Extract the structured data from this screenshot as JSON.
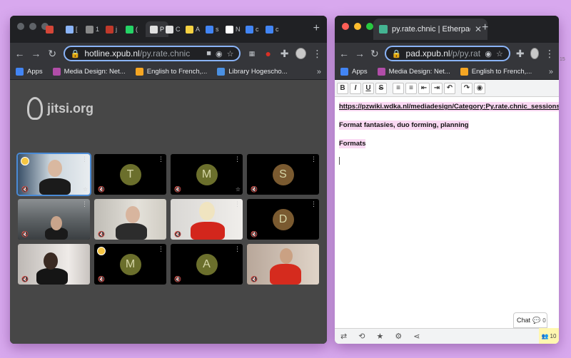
{
  "left_window": {
    "tabs": [
      {
        "label": "",
        "favicon_color": "#d44638",
        "icon": "gmail-icon"
      },
      {
        "label": "[",
        "favicon_color": "#8ab4f8",
        "icon": "page-icon"
      },
      {
        "label": "1",
        "favicon_color": "#888888",
        "icon": "box-icon"
      },
      {
        "label": "j",
        "favicon_color": "#c0392b",
        "icon": "red-icon"
      },
      {
        "label": "(",
        "favicon_color": "#25d366",
        "icon": "whatsapp-icon"
      },
      {
        "label": "P",
        "favicon_color": "#e0e0e0",
        "icon": "jitsi-icon",
        "active": true
      },
      {
        "label": "C",
        "favicon_color": "#e0e0e0",
        "icon": "page-icon"
      },
      {
        "label": "A",
        "favicon_color": "#f5d142",
        "icon": "page-icon"
      },
      {
        "label": "s",
        "favicon_color": "#4285f4",
        "icon": "google-icon"
      },
      {
        "label": "N",
        "favicon_color": "#ffffff",
        "icon": "wikipedia-icon"
      },
      {
        "label": "c",
        "favicon_color": "#4285f4",
        "icon": "google-icon"
      },
      {
        "label": "c",
        "favicon_color": "#4285f4",
        "icon": "google-icon"
      }
    ],
    "url_host": "hotline.xpub.nl",
    "url_path": "/py.rate.chnic",
    "bookmarks": [
      {
        "label": "Apps",
        "color": "#4285f4"
      },
      {
        "label": "Media Design: Net...",
        "color": "#b14da8"
      },
      {
        "label": "English to French,...",
        "color": "#f5a623"
      },
      {
        "label": "Library  Hogescho...",
        "color": "#4a90e2"
      }
    ],
    "logo_text": "jitsi.org",
    "tiles": [
      {
        "kind": "video",
        "scene": "person-headphones",
        "active": true,
        "badge": true,
        "star": true
      },
      {
        "kind": "avatar",
        "letter": "T",
        "color": "#6b6f2c"
      },
      {
        "kind": "avatar",
        "letter": "M",
        "color": "#6b6f2c",
        "star": true
      },
      {
        "kind": "avatar",
        "letter": "S",
        "color": "#7a5a30"
      },
      {
        "kind": "video",
        "scene": "room-dark"
      },
      {
        "kind": "video",
        "scene": "man-glasses"
      },
      {
        "kind": "video",
        "scene": "woman-red"
      },
      {
        "kind": "avatar",
        "letter": "D",
        "color": "#7a5a30"
      },
      {
        "kind": "video",
        "scene": "woman-dark"
      },
      {
        "kind": "avatar",
        "letter": "M",
        "color": "#6b6f2c",
        "badge": true
      },
      {
        "kind": "avatar",
        "letter": "A",
        "color": "#6b6f2c"
      },
      {
        "kind": "video",
        "scene": "man-red"
      }
    ]
  },
  "right_window": {
    "tab_title": "py.rate.chnic | Etherpad",
    "url_host": "pad.xpub.nl",
    "url_path": "/p/py.rate.chnic",
    "bookmarks": [
      {
        "label": "Apps",
        "color": "#4285f4"
      },
      {
        "label": "Media Design: Net...",
        "color": "#b14da8"
      },
      {
        "label": "English to French,...",
        "color": "#f5a623"
      }
    ],
    "toolbar": [
      "B",
      "I",
      "U",
      "S",
      "ol",
      "ul",
      "indent",
      "outdent",
      "undo",
      "redo",
      "eye"
    ],
    "doc_lines": [
      {
        "text": "https://pzwiki.wdka.nl/mediadesign/Category:Py.rate.chnic_sessions",
        "link": true
      },
      {
        "text": "Format fantasies, duo forming, planning",
        "link": false
      },
      {
        "text": "Formats",
        "link": false
      }
    ],
    "chat_label": "Chat",
    "chat_count": "0",
    "users_count": "10",
    "edge_number": "15"
  },
  "colors": {
    "desktop": "#d8a8ee",
    "chrome_dark": "#202124",
    "chrome_toolbar": "#35363a",
    "jitsi_bg": "#474747",
    "pad_highlight": "#fad9f3",
    "users_badge": "#fff7b0"
  }
}
